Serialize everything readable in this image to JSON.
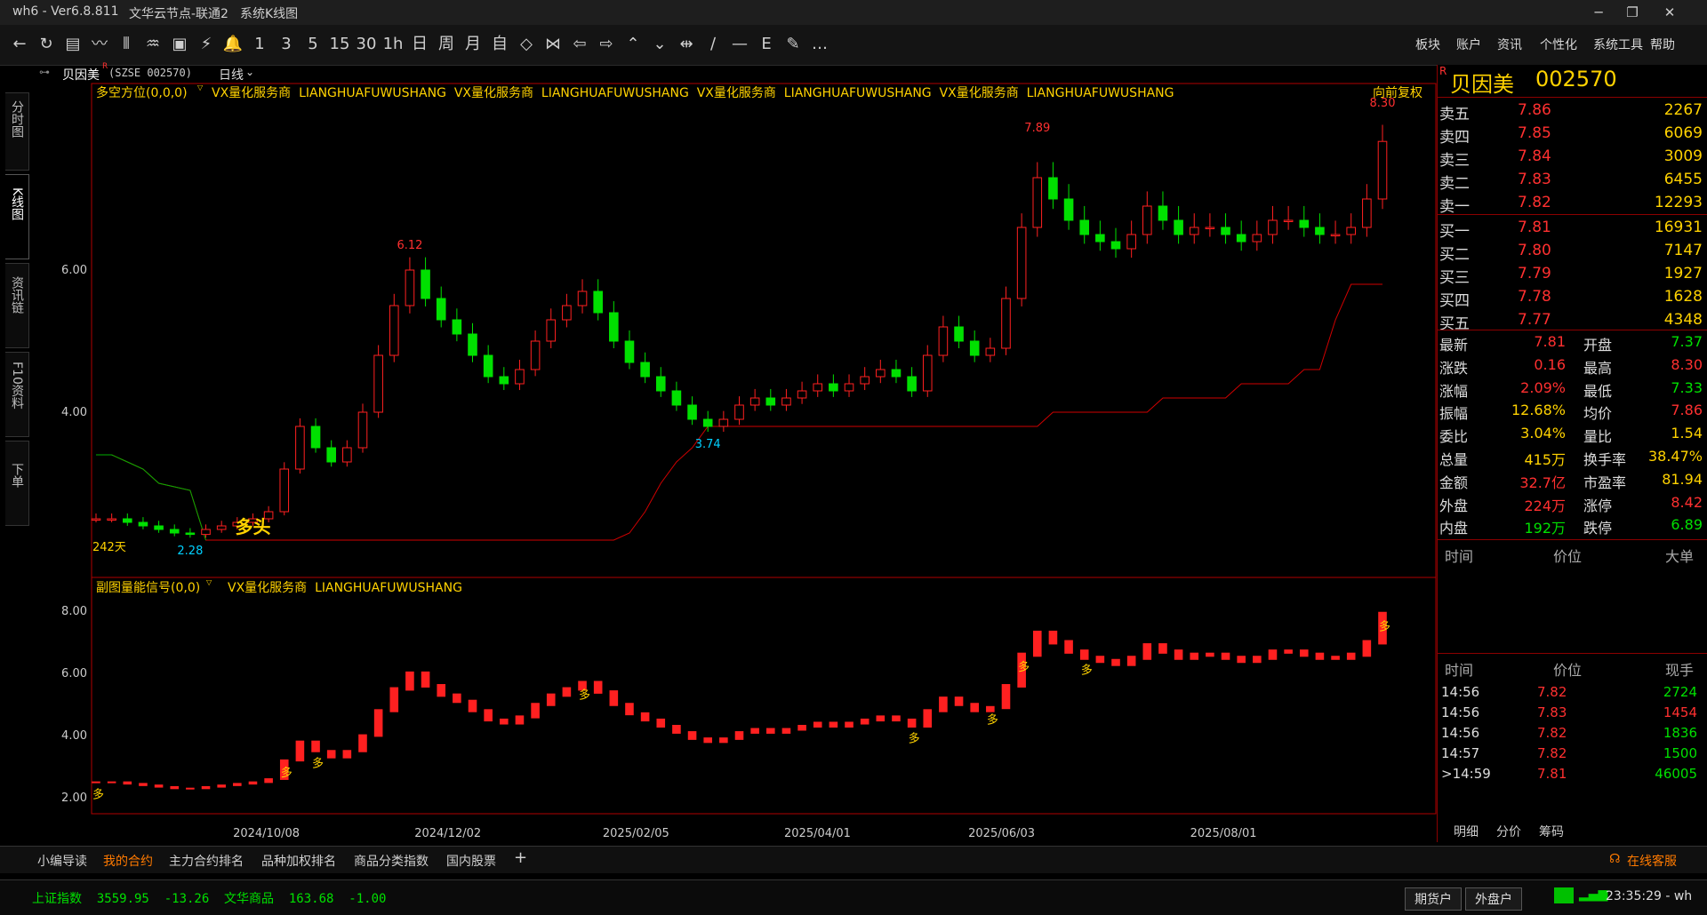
{
  "titlebar": {
    "app": "wh6 - Ver6.8.811",
    "node": "文华云节点-联通2",
    "view": "系统K线图",
    "minimize": "─",
    "maximize": "❐",
    "close": "✕"
  },
  "toolbar": {
    "icons": [
      "←",
      "↻",
      "▤",
      "〰",
      "⫴",
      "♒",
      "▣",
      "⚡",
      "🔔",
      "1",
      "3",
      "5",
      "15",
      "30",
      "1h",
      "日",
      "周",
      "月",
      "自",
      "◇",
      "⋈",
      "⇦",
      "⇨",
      "⌃",
      "⌄",
      "⇹",
      "∕",
      "—",
      "E",
      "✎",
      "…"
    ],
    "menus": [
      "板块",
      "账户",
      "资讯",
      "个性化",
      "系统工具",
      "帮助"
    ]
  },
  "sidetabs": [
    "分时图",
    "K线图",
    "资讯链",
    "F10资料",
    "下单"
  ],
  "chartbar": {
    "name": "贝因美",
    "sup": "R",
    "code": "(SZSE 002570)",
    "period": "日线",
    "period_icon": "chevron-down"
  },
  "main_header": {
    "indicator": "多空方位(0,0,0)",
    "text": "VX量化服务商  LIANGHUAFUWUSHANG  VX量化服务商  LIANGHUAFUWUSHANG  VX量化服务商  LIANGHUAFUWUSHANG  VX量化服务商  LIANGHUAFUWUSHANG",
    "right": "向前复权"
  },
  "sub_header": {
    "indicator": "副图量能信号(0,0)",
    "text": "VX量化服务商  LIANGHUAFUWUSHANG"
  },
  "annotations": {
    "high1": "6.12",
    "high2": "7.89",
    "high3": "8.30",
    "low1": "3.74",
    "low2": "2.28",
    "days": "242天",
    "bull": "多头",
    "duo": "多"
  },
  "colors": {
    "up": "#ff2020",
    "down": "#00e000",
    "axis": "#b00000",
    "yellow": "#ffd200",
    "cyan": "#00d0ff"
  },
  "chart_data": [
    {
      "type": "candlestick",
      "title": "",
      "x_ticks": [
        "2024/10/08",
        "2024/12/02",
        "2025/02/05",
        "2025/04/01",
        "2025/06/03",
        "2025/08/01"
      ],
      "y_ticks": [
        "6.00",
        "4.00"
      ],
      "ylim": [
        1.9,
        8.4
      ],
      "series": [
        {
          "name": "close",
          "values": [
            2.5,
            2.5,
            2.45,
            2.4,
            2.35,
            2.3,
            2.28,
            2.35,
            2.4,
            2.45,
            2.5,
            2.6,
            3.2,
            3.8,
            3.5,
            3.3,
            3.5,
            4.0,
            4.8,
            5.5,
            6.0,
            5.6,
            5.3,
            5.1,
            4.8,
            4.5,
            4.4,
            4.6,
            5.0,
            5.3,
            5.5,
            5.7,
            5.4,
            5.0,
            4.7,
            4.5,
            4.3,
            4.1,
            3.9,
            3.8,
            3.9,
            4.1,
            4.2,
            4.1,
            4.2,
            4.3,
            4.4,
            4.3,
            4.4,
            4.5,
            4.6,
            4.5,
            4.3,
            4.8,
            5.2,
            5.0,
            4.8,
            4.9,
            5.6,
            6.6,
            7.3,
            7.0,
            6.7,
            6.5,
            6.4,
            6.3,
            6.5,
            6.9,
            6.7,
            6.5,
            6.6,
            6.6,
            6.5,
            6.4,
            6.5,
            6.7,
            6.7,
            6.6,
            6.5,
            6.5,
            6.6,
            7.0,
            7.81
          ]
        },
        {
          "name": "stop_line",
          "values": [
            3.4,
            3.4,
            3.3,
            3.2,
            3.0,
            2.95,
            2.9,
            2.2,
            2.2,
            2.2,
            2.2,
            2.2,
            2.2,
            2.2,
            2.2,
            2.2,
            2.2,
            2.2,
            2.2,
            2.2,
            2.2,
            2.2,
            2.2,
            2.2,
            2.2,
            2.2,
            2.2,
            2.2,
            2.2,
            2.2,
            2.2,
            2.2,
            2.2,
            2.2,
            2.3,
            2.6,
            3.0,
            3.3,
            3.5,
            3.8,
            3.8,
            3.8,
            3.8,
            3.8,
            3.8,
            3.8,
            3.8,
            3.8,
            3.8,
            3.8,
            3.8,
            3.8,
            3.8,
            3.8,
            3.8,
            3.8,
            3.8,
            3.8,
            3.8,
            3.8,
            3.8,
            4.0,
            4.0,
            4.0,
            4.0,
            4.0,
            4.0,
            4.0,
            4.2,
            4.2,
            4.2,
            4.2,
            4.2,
            4.4,
            4.4,
            4.4,
            4.4,
            4.6,
            4.6,
            5.3,
            5.8,
            5.8,
            5.8
          ]
        }
      ]
    },
    {
      "type": "bar",
      "title": "",
      "y_ticks": [
        "8.00",
        "6.00",
        "4.00",
        "2.00"
      ],
      "ylim": [
        1.6,
        8.6
      ],
      "series": [
        {
          "name": "volume_signal",
          "values": [
            2.5,
            2.5,
            2.45,
            2.4,
            2.35,
            2.3,
            2.3,
            2.35,
            2.4,
            2.45,
            2.5,
            2.6,
            3.2,
            3.8,
            3.5,
            3.3,
            3.5,
            4.0,
            4.8,
            5.5,
            6.0,
            5.6,
            5.3,
            5.1,
            4.8,
            4.5,
            4.4,
            4.6,
            5.0,
            5.3,
            5.5,
            5.7,
            5.4,
            5.0,
            4.7,
            4.5,
            4.3,
            4.1,
            3.9,
            3.8,
            3.9,
            4.1,
            4.2,
            4.1,
            4.2,
            4.3,
            4.4,
            4.3,
            4.4,
            4.5,
            4.6,
            4.5,
            4.3,
            4.8,
            5.2,
            5.0,
            4.8,
            4.9,
            5.6,
            6.6,
            7.3,
            7.0,
            6.7,
            6.5,
            6.4,
            6.3,
            6.5,
            6.9,
            6.7,
            6.5,
            6.6,
            6.6,
            6.5,
            6.4,
            6.5,
            6.7,
            6.7,
            6.6,
            6.5,
            6.5,
            6.6,
            7.0,
            7.9
          ]
        }
      ]
    }
  ],
  "quote": {
    "name": "贝因美",
    "code": "002570",
    "sup": "R",
    "asks": [
      {
        "label": "卖五",
        "price": "7.86",
        "vol": "2267"
      },
      {
        "label": "卖四",
        "price": "7.85",
        "vol": "6069"
      },
      {
        "label": "卖三",
        "price": "7.84",
        "vol": "3009"
      },
      {
        "label": "卖二",
        "price": "7.83",
        "vol": "6455"
      },
      {
        "label": "卖一",
        "price": "7.82",
        "vol": "12293"
      }
    ],
    "bids": [
      {
        "label": "买一",
        "price": "7.81",
        "vol": "16931"
      },
      {
        "label": "买二",
        "price": "7.80",
        "vol": "7147"
      },
      {
        "label": "买三",
        "price": "7.79",
        "vol": "1927"
      },
      {
        "label": "买四",
        "price": "7.78",
        "vol": "1628"
      },
      {
        "label": "买五",
        "price": "7.77",
        "vol": "4348"
      }
    ],
    "stats": [
      {
        "l1": "最新",
        "v1": "7.81",
        "c1": "red",
        "l2": "开盘",
        "v2": "7.37",
        "c2": "green"
      },
      {
        "l1": "涨跌",
        "v1": "0.16",
        "c1": "red",
        "l2": "最高",
        "v2": "8.30",
        "c2": "red"
      },
      {
        "l1": "涨幅",
        "v1": "2.09%",
        "c1": "red",
        "l2": "最低",
        "v2": "7.33",
        "c2": "green"
      },
      {
        "l1": "振幅",
        "v1": "12.68%",
        "c1": "yellow",
        "l2": "均价",
        "v2": "7.86",
        "c2": "red"
      },
      {
        "l1": "委比",
        "v1": "3.04%",
        "c1": "yellow",
        "l2": "量比",
        "v2": "1.54",
        "c2": "yellow"
      },
      {
        "l1": "总量",
        "v1": "415万",
        "c1": "yellow",
        "l2": "换手率",
        "v2": "38.47%",
        "c2": "yellow"
      },
      {
        "l1": "金额",
        "v1": "32.7亿",
        "c1": "red",
        "l2": "市盈率",
        "v2": "81.94",
        "c2": "yellow"
      },
      {
        "l1": "外盘",
        "v1": "224万",
        "c1": "red",
        "l2": "涨停",
        "v2": "8.42",
        "c2": "red"
      },
      {
        "l1": "内盘",
        "v1": "192万",
        "c1": "green",
        "l2": "跌停",
        "v2": "6.89",
        "c2": "green"
      }
    ],
    "big_header": {
      "time": "时间",
      "price": "价位",
      "vol": "大单"
    },
    "tick_header": {
      "time": "时间",
      "price": "价位",
      "vol": "现手"
    },
    "ticks": [
      {
        "time": "14:56",
        "price": "7.82",
        "vol": "2724",
        "vc": "green"
      },
      {
        "time": "14:56",
        "price": "7.83",
        "vol": "1454",
        "vc": "red"
      },
      {
        "time": "14:56",
        "price": "7.82",
        "vol": "1836",
        "vc": "green"
      },
      {
        "time": "14:57",
        "price": "7.82",
        "vol": "1500",
        "vc": "green"
      },
      {
        "time": ">14:59",
        "price": "7.81",
        "vol": "46005",
        "vc": "green"
      }
    ],
    "tabs": [
      "明细",
      "分价",
      "筹码"
    ]
  },
  "bottom_tabs": [
    "小编导读",
    "我的合约",
    "主力合约排名",
    "品种加权排名",
    "商品分类指数",
    "国内股票",
    "+"
  ],
  "online_service": "在线客服",
  "status": {
    "idx1": "上证指数  3559.95  -13.26",
    "idx2": "文华商品  163.68  -1.00",
    "btn1": "期货户",
    "btn2": "外盘户",
    "time": "23:35:29 - wh"
  }
}
